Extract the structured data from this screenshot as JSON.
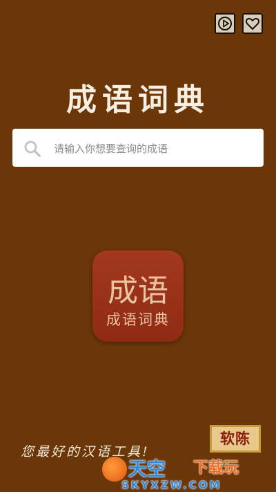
{
  "app": {
    "title": "成语词典",
    "tagline": "您最好的汉语工具!"
  },
  "toolbar": {
    "play_icon": "play-circle-icon",
    "favorite_icon": "heart-icon"
  },
  "search": {
    "placeholder": "请输入你想要查询的成语",
    "value": ""
  },
  "app_icon": {
    "big_text": "成语",
    "small_text": "成语词典"
  },
  "badge": {
    "label": "软陈"
  },
  "watermark": {
    "main": "天空",
    "sub": "下载玩",
    "domain": "SKYXZW.COM"
  },
  "colors": {
    "background": "#6b3608",
    "icon_red": "#a3381f",
    "title_text": "#f7efe2"
  }
}
